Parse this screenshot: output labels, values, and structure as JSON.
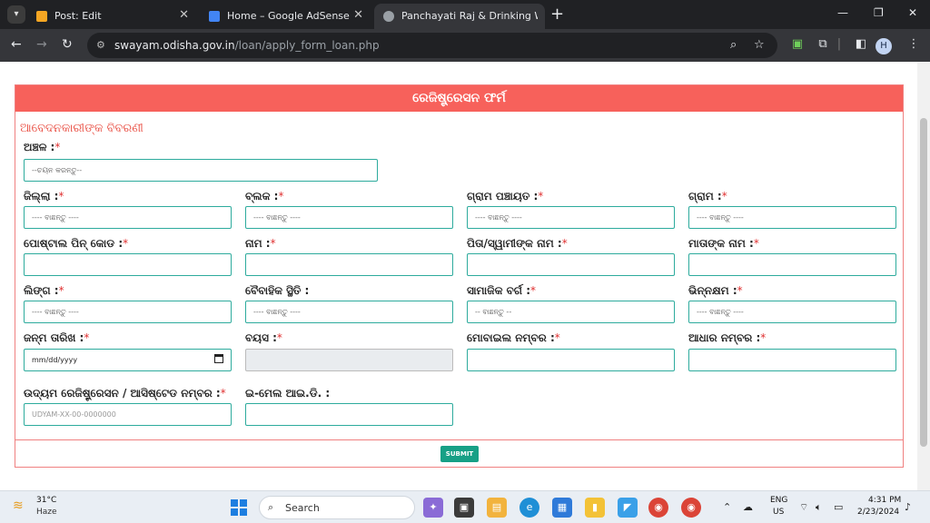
{
  "browser": {
    "tabs": [
      {
        "title": "Post: Edit",
        "favicon_color": "#f5a623"
      },
      {
        "title": "Home – Google AdSense",
        "favicon_color": "#4285f4"
      },
      {
        "title": "Panchayati Raj & Drinking Wate",
        "favicon_color": "#9aa0a6"
      }
    ],
    "url_host": "swayam.odisha.gov.in",
    "url_path": "/loan/apply_form_loan.php",
    "profile_initial": "H"
  },
  "form": {
    "header": "ରେଜିଷ୍ଟ୍ରେସନ ଫର୍ମ",
    "section_title": "ଆବେଦନକାରୀଙ୍କ ବିବରଣୀ",
    "area_label": "ଅଞ୍ଚଳ :",
    "area_required": "*",
    "area_placeholder": "--ଚୟନ କରନ୍ତୁ--",
    "select_placeholder": "---- ବାଛନ୍ତୁ ----",
    "select_placeholder_short": "-- ବାଛନ୍ତୁ --",
    "required_mark": "*",
    "labels": {
      "district": "ଜିଲ୍ଲା :",
      "block": "ବ୍ଲକ :",
      "gram_panchayat": "ଗ୍ରାମ ପଞ୍ଚାୟତ :",
      "village": "ଗ୍ରାମ :",
      "pin_code": "ପୋଷ୍ଟାଲ ପିନ୍ କୋଡ :",
      "name": "ନାମ :",
      "father_name": "ପିତା/ସ୍ୱାମୀଙ୍କ ନାମ :",
      "mother_name": "ମାତାଙ୍କ ନାମ :",
      "gender": "ଲିଙ୍ଗ :",
      "marital_status": "ବୈବାହିକ ସ୍ଥିତି :",
      "social_category": "ସାମାଜିକ ବର୍ଗ :",
      "disability": "ଭିନ୍ନକ୍ଷମ :",
      "dob": "ଜନ୍ମ ତାରିଖ :",
      "age": "ବୟସ :",
      "mobile": "ମୋବାଇଲ ନମ୍ବର :",
      "aadhaar": "ଆଧାର ନମ୍ବର :",
      "udyam": "ଉଦ୍ୟମ ରେଜିଷ୍ଟ୍ରେସନ / ଆସିଷ୍ଟେଡ ନମ୍ବର :",
      "email": "ଇ-ମେଲ ଆଇ.ଡି. :"
    },
    "dob_placeholder": "mm/dd/yyyy",
    "udyam_placeholder": "UDYAM-XX-00-0000000",
    "submit_label": "SUBMIT"
  },
  "taskbar": {
    "temperature": "31°C",
    "weather": "Haze",
    "search_label": "Search",
    "lang_line1": "ENG",
    "lang_line2": "US",
    "time": "4:31 PM",
    "date": "2/23/2024"
  },
  "colors": {
    "header_bg": "#f7615b",
    "section_title": "#e8463a",
    "input_border": "#2dab9d",
    "submit_bg": "#17a086"
  }
}
